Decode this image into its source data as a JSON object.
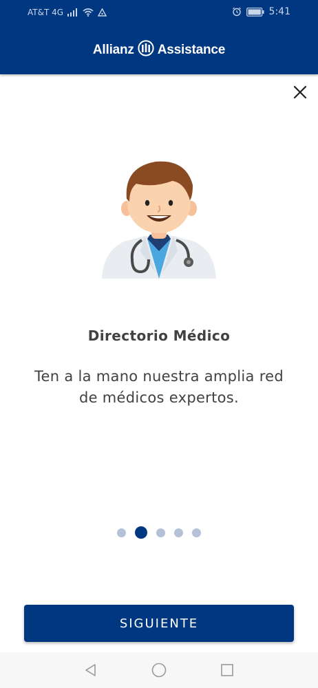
{
  "status_bar": {
    "carrier": "AT&T 4G",
    "time": "5:41",
    "icons": [
      "signal-icon",
      "wifi-icon",
      "hotspot-icon",
      "alarm-icon",
      "battery-icon"
    ]
  },
  "header": {
    "brand_left": "Allianz",
    "brand_right": "Assistance",
    "logo_icon": "allianz-logo-icon",
    "background_color": "#003781"
  },
  "close": {
    "icon": "close-icon"
  },
  "onboarding": {
    "illustration_icon": "doctor-illustration-icon",
    "title": "Directorio Médico",
    "description": "Ten a la mano nuestra amplia red de médicos expertos.",
    "pagination": {
      "total": 5,
      "current": 2
    }
  },
  "next_button": {
    "label": "SIGUIENTE"
  },
  "nav_bar": {
    "icons": [
      "back-icon",
      "home-icon",
      "recents-icon"
    ]
  },
  "colors": {
    "primary": "#003781",
    "inactive_dot": "#b4c1d7",
    "text": "#414141"
  }
}
